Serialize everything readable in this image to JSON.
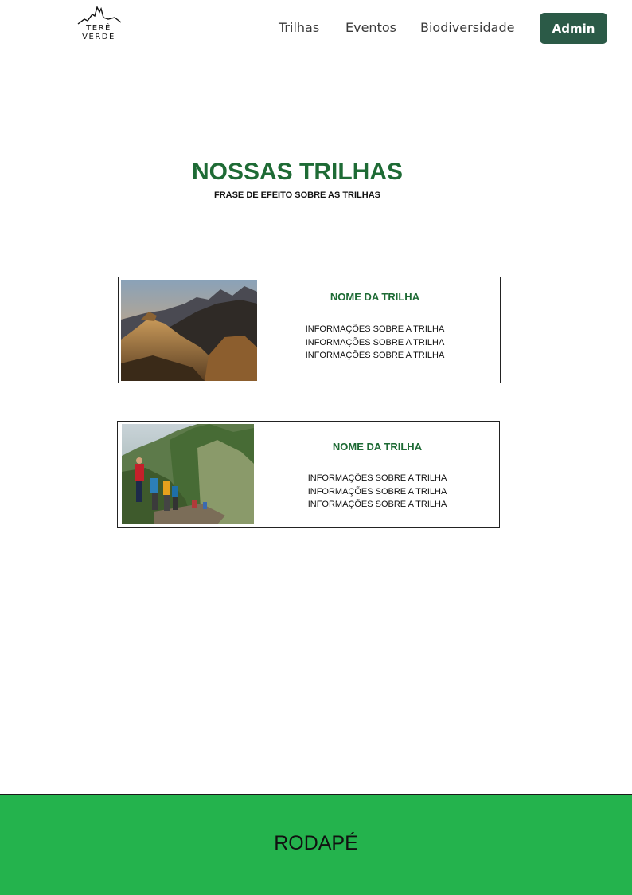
{
  "header": {
    "logo_line1": "TERÊ",
    "logo_line2": "VERDE",
    "nav": [
      "Trilhas",
      "Eventos",
      "Biodiversidade"
    ],
    "admin_label": "Admin"
  },
  "hero": {
    "title": "NOSSAS TRILHAS",
    "subtitle": "FRASE DE EFEITO SOBRE AS TRILHAS"
  },
  "trails": [
    {
      "name": "NOME DA TRILHA",
      "info": [
        "INFORMAÇÕES SOBRE A TRILHA",
        "INFORMAÇÕES SOBRE A TRILHA",
        "INFORMAÇÕES SOBRE A TRILHA"
      ],
      "image": "mountain-rock-photo"
    },
    {
      "name": "NOME DA TRILHA",
      "info": [
        "INFORMAÇÕES SOBRE A TRILHA",
        "INFORMAÇÕES SOBRE A TRILHA",
        "INFORMAÇÕES SOBRE A TRILHA"
      ],
      "image": "hikers-ridge-photo"
    }
  ],
  "footer": {
    "label": "RODAPÉ"
  },
  "colors": {
    "brand_green": "#1e6b35",
    "admin_button": "#2b5a47",
    "footer_green": "#24b34d"
  }
}
